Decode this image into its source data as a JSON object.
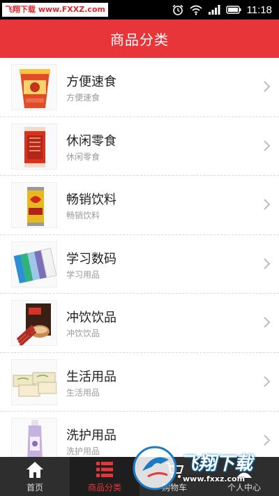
{
  "status_bar": {
    "watermark": "飞翔下载 www.FXXZ.com",
    "time": "11:18",
    "icons": [
      "alarm-icon",
      "wifi-icon",
      "signal-icon",
      "battery-icon"
    ]
  },
  "header": {
    "title": "商品分类"
  },
  "categories": [
    {
      "title": "方便速食",
      "subtitle": "方便速食",
      "image": "instant-noodle-cup"
    },
    {
      "title": "休闲零食",
      "subtitle": "休闲零食",
      "image": "snack-bag"
    },
    {
      "title": "畅销饮料",
      "subtitle": "畅销饮料",
      "image": "drink-can"
    },
    {
      "title": "学习数码",
      "subtitle": "学习用品",
      "image": "notebooks"
    },
    {
      "title": "冲饮饮品",
      "subtitle": "冲饮饮品",
      "image": "coffee-pack"
    },
    {
      "title": "生活用品",
      "subtitle": "生活用品",
      "image": "tissue-boxes"
    },
    {
      "title": "洗护用品",
      "subtitle": "洗护用品",
      "image": "lotion-bottle"
    }
  ],
  "bottom_nav": [
    {
      "label": "首页",
      "icon": "home-icon",
      "active": false
    },
    {
      "label": "商品分类",
      "icon": "list-icon",
      "active": true
    },
    {
      "label": "购物车",
      "icon": "cart-icon",
      "active": false
    },
    {
      "label": "个人中心",
      "icon": "user-icon",
      "active": false
    }
  ],
  "watermark_bottom": {
    "logo_text": "飞翔下载",
    "url": "www.fxxz.com"
  },
  "colors": {
    "accent": "#e8353a",
    "nav_bg": "#2e2e2e"
  }
}
